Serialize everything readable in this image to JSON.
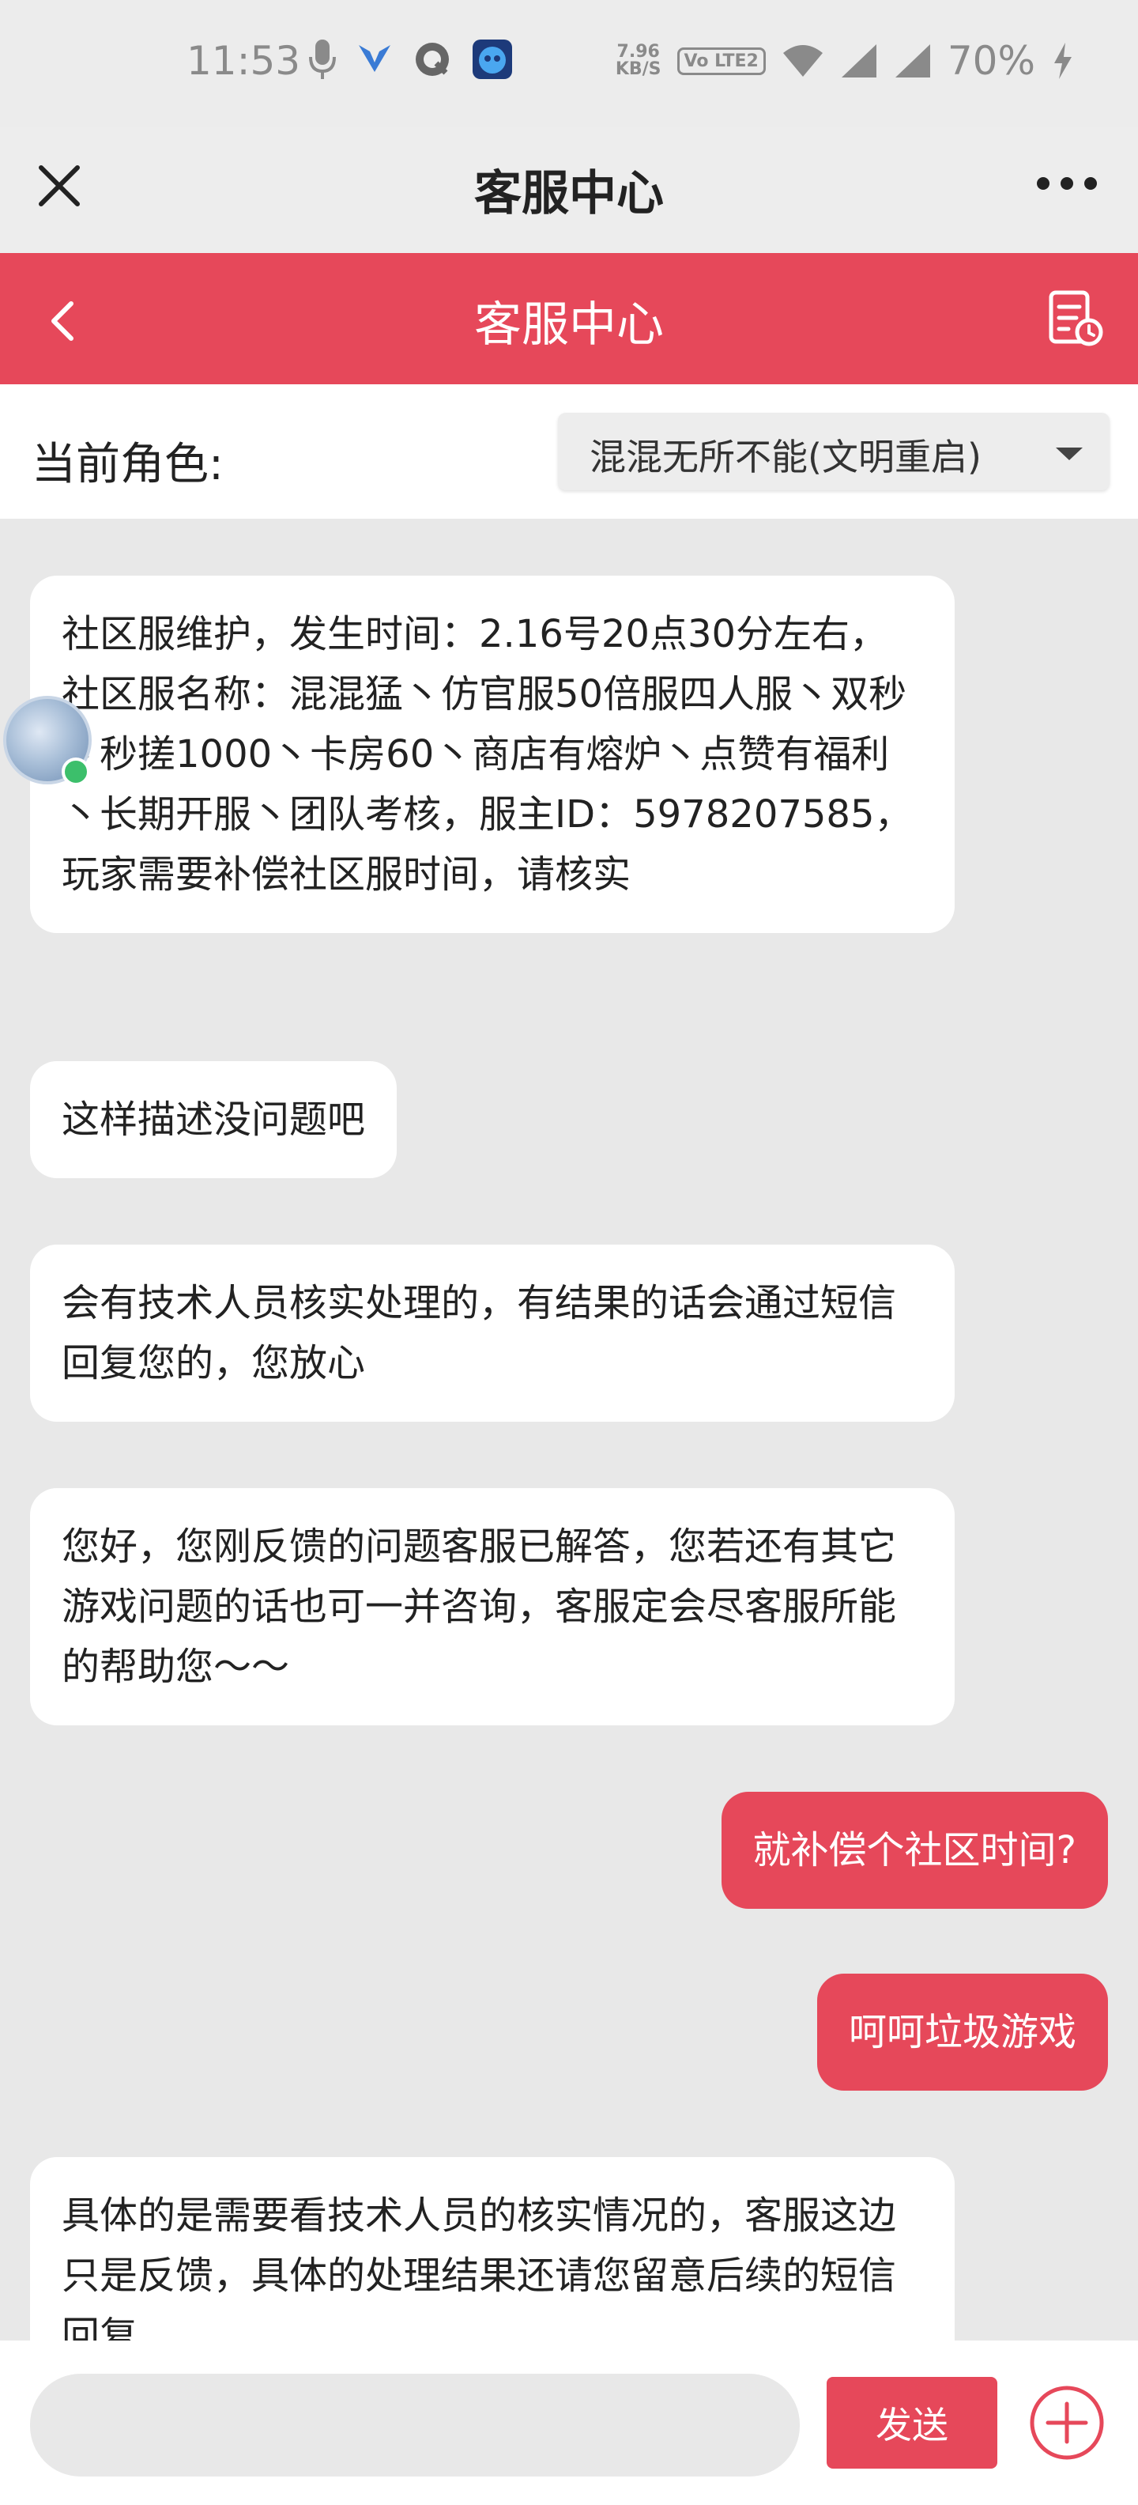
{
  "status_bar": {
    "time": "11:53",
    "net_speed_value": "7.96",
    "net_speed_unit": "KB/S",
    "lte_label": "Vo LTE2",
    "battery": "70%",
    "icons": [
      "mic-icon",
      "app-icon",
      "app-q-icon",
      "app-robot-icon",
      "wifi-icon",
      "signal-icon",
      "signal-icon",
      "charging-icon"
    ]
  },
  "webview": {
    "title": "客服中心"
  },
  "header": {
    "title": "客服中心",
    "color": "#e6485a"
  },
  "role": {
    "label": "当前角色:",
    "selected": "混混无所不能(文明重启)"
  },
  "messages": [
    {
      "side": "left",
      "text": "社区服维护，发生时间：2.16号20点30分左右，社区服名称：混混猛丶仿官服50倍服四人服丶双秒丶秒搓1000丶卡房60丶商店有熔炉丶点赞有福利丶长期开服丶团队考核，服主ID：5978207585，玩家需要补偿社区服时间，请核实"
    },
    {
      "side": "left",
      "text": "这样描述没问题吧"
    },
    {
      "side": "left",
      "text": "会有技术人员核实处理的，有结果的话会通过短信回复您的，您放心"
    },
    {
      "side": "left",
      "text": "您好，您刚反馈的问题客服已解答，您若还有其它游戏问题的话也可一并咨询，客服定会尽客服所能的帮助您～～"
    },
    {
      "side": "right",
      "text": "就补偿个社区时间?"
    },
    {
      "side": "right",
      "text": "呵呵垃圾游戏"
    },
    {
      "side": "left",
      "text": "具体的是需要看技术人员的核实情况的，客服这边只是反馈，具体的处理结果还请您留意后续的短信回复"
    }
  ],
  "input": {
    "placeholder": "",
    "send_label": "发送"
  }
}
